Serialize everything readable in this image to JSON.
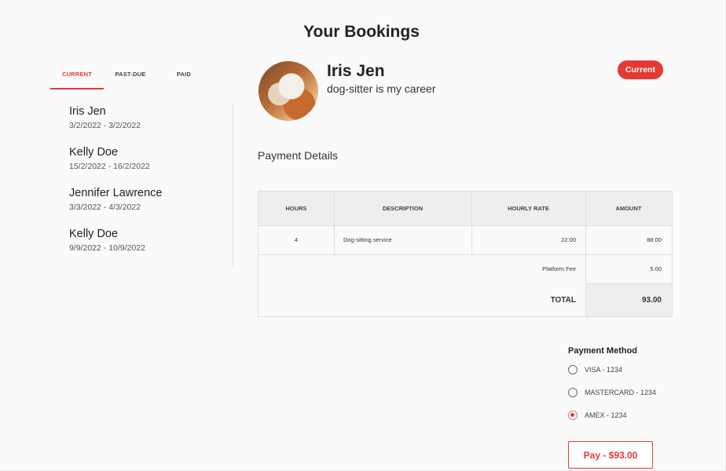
{
  "page": {
    "title": "Your Bookings"
  },
  "tabs": [
    {
      "label": "CURRENT",
      "active": true
    },
    {
      "label": "PAST-DUE",
      "active": false
    },
    {
      "label": "PAID",
      "active": false
    }
  ],
  "bookings": [
    {
      "name": "Iris Jen",
      "dates": "3/2/2022 - 3/2/2022"
    },
    {
      "name": "Kelly Doe",
      "dates": "15/2/2022 - 16/2/2022"
    },
    {
      "name": "Jennifer Lawrence",
      "dates": "3/3/2022 - 4/3/2022"
    },
    {
      "name": "Kelly Doe",
      "dates": "9/9/2022 - 10/9/2022"
    }
  ],
  "profile": {
    "name": "Iris Jen",
    "tagline": "dog-sitter is my career",
    "status": "Current"
  },
  "payment_details": {
    "title": "Payment Details",
    "columns": [
      "HOURS",
      "DESCRIPTION",
      "HOURLY RATE",
      "AMOUNT"
    ],
    "rows": [
      {
        "hours": "4",
        "description": "Dog-sitting service",
        "rate": "22.00",
        "amount": "88.00"
      }
    ],
    "platform_fee_label": "Platform Fee",
    "platform_fee": "5.00",
    "total_label": "TOTAL",
    "total": "93.00"
  },
  "payment_method": {
    "title": "Payment Method",
    "options": [
      {
        "label": "VISA - 1234",
        "selected": false
      },
      {
        "label": "MASTERCARD - 1234",
        "selected": false
      },
      {
        "label": "AMEX - 1234",
        "selected": true
      }
    ]
  },
  "pay_button": {
    "label": "Pay - $93.00"
  },
  "colors": {
    "accent": "#e53935",
    "header_bg": "#eeeeee",
    "background": "#fafafa"
  }
}
